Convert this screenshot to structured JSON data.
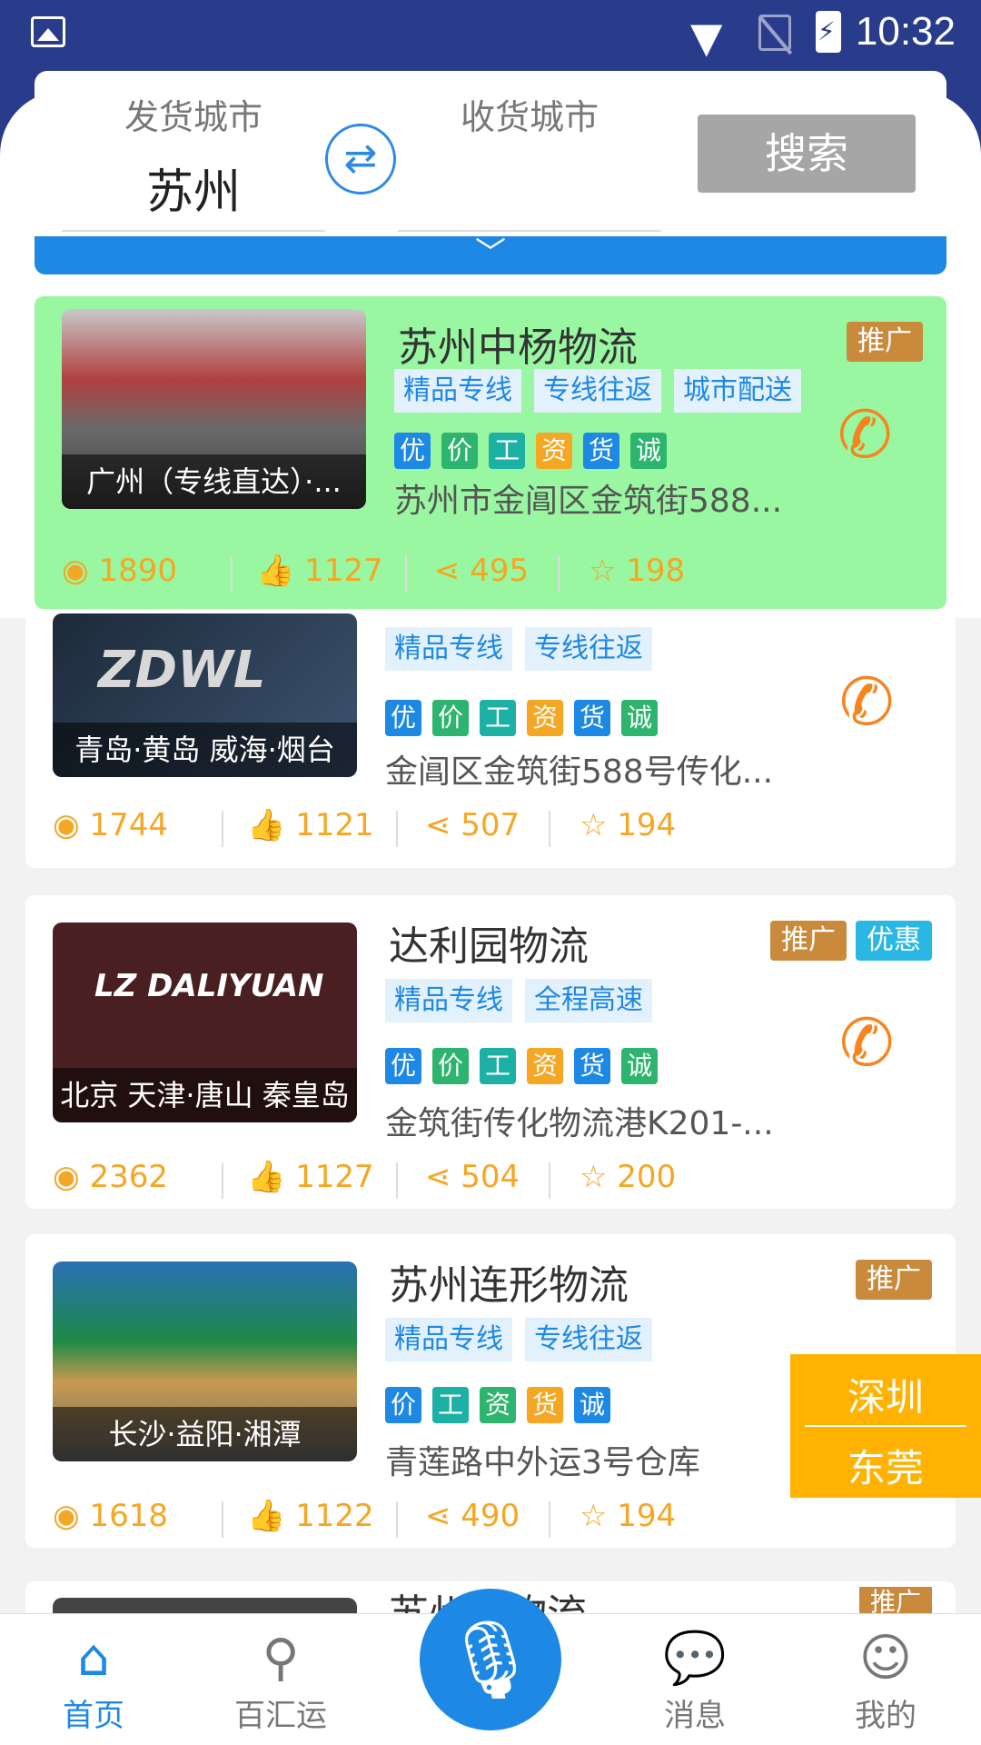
{
  "status": {
    "time": "10:32"
  },
  "search": {
    "from_label": "发货城市",
    "from_value": "苏州",
    "to_label": "收货城市",
    "to_value": "",
    "button": "搜索"
  },
  "cards": [
    {
      "title": "苏州中杨物流",
      "caption": "广州（专线直达）·...",
      "tags": [
        "精品专线",
        "专线往返",
        "城市配送"
      ],
      "marks": [
        "优",
        "价",
        "工",
        "资",
        "货",
        "诚"
      ],
      "address": "苏州市金阊区金筑街588...",
      "badges": [
        "推广"
      ],
      "stats": {
        "views": "1890",
        "likes": "1127",
        "shares": "495",
        "stars": "198"
      }
    },
    {
      "title": "",
      "caption": "青岛·黄岛 威海·烟台",
      "tags": [
        "精品专线",
        "专线往返"
      ],
      "marks": [
        "优",
        "价",
        "工",
        "资",
        "货",
        "诚"
      ],
      "address": "金阊区金筑街588号传化...",
      "badges": [],
      "stats": {
        "views": "1744",
        "likes": "1121",
        "shares": "507",
        "stars": "194"
      }
    },
    {
      "title": "达利园物流",
      "caption": "北京 天津·唐山 秦皇岛",
      "tags": [
        "精品专线",
        "全程高速"
      ],
      "marks": [
        "优",
        "价",
        "工",
        "资",
        "货",
        "诚"
      ],
      "address": "金筑街传化物流港K201-...",
      "badges": [
        "推广",
        "优惠"
      ],
      "stats": {
        "views": "2362",
        "likes": "1127",
        "shares": "504",
        "stars": "200"
      }
    },
    {
      "title": "苏州连形物流",
      "caption": "长沙·益阳·湘潭",
      "tags": [
        "精品专线",
        "专线往返"
      ],
      "marks": [
        "价",
        "工",
        "资",
        "货",
        "诚"
      ],
      "address": "青莲路中外运3号仓库",
      "badges": [
        "推广"
      ],
      "stats": {
        "views": "1618",
        "likes": "1122",
        "shares": "490",
        "stars": "194"
      }
    }
  ],
  "partial": {
    "title": "苏州...物流",
    "badge": "推广"
  },
  "floating": {
    "line1": "深圳",
    "line2": "东莞"
  },
  "tabs": [
    {
      "label": "首页",
      "icon": "home-icon"
    },
    {
      "label": "百汇运",
      "icon": "search-icon"
    },
    {
      "label": "消息",
      "icon": "message-icon"
    },
    {
      "label": "我的",
      "icon": "user-icon"
    }
  ],
  "colors": {
    "primary": "#1e88e5",
    "status_bar": "#293c8c",
    "accent": "#f5a623",
    "promo": "#c98a3b",
    "highlight_card": "#98f7a0"
  }
}
